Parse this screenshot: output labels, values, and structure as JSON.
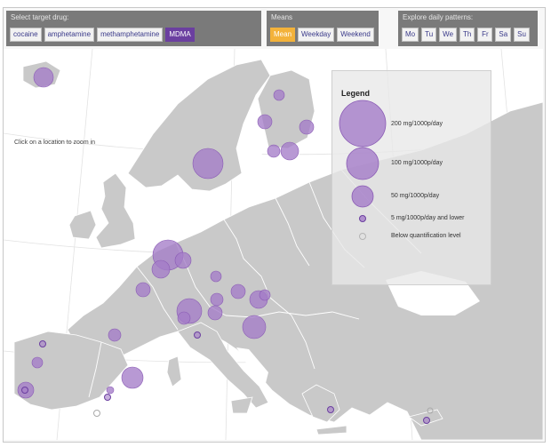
{
  "drug_panel": {
    "title": "Select target drug:",
    "options": [
      "cocaine",
      "amphetamine",
      "methamphetamine",
      "MDMA"
    ],
    "selected": "MDMA"
  },
  "means_panel": {
    "title": "Means",
    "options": [
      "Mean",
      "Weekday",
      "Weekend"
    ],
    "selected": "Mean"
  },
  "daily_panel": {
    "title": "Explore daily patterns:",
    "days": [
      "Mo",
      "Tu",
      "We",
      "Th",
      "Fr",
      "Sa",
      "Su"
    ]
  },
  "map": {
    "zoom_hint": "Click on a location to zoom in",
    "colors": {
      "land": "#c9c9c9",
      "sea": "#ffffff",
      "bubble_fill": "#a47cc8",
      "bubble_stroke": "#8a5bb5"
    }
  },
  "legend": {
    "title": "Legend",
    "items": [
      {
        "label": "200 mg/1000p/day",
        "value": 200
      },
      {
        "label": "100 mg/1000p/day",
        "value": 100
      },
      {
        "label": "50 mg/1000p/day",
        "value": 50
      },
      {
        "label": "5 mg/1000p/day and lower",
        "value": 5
      },
      {
        "label": "Below quantification level",
        "value": 0
      }
    ]
  }
}
